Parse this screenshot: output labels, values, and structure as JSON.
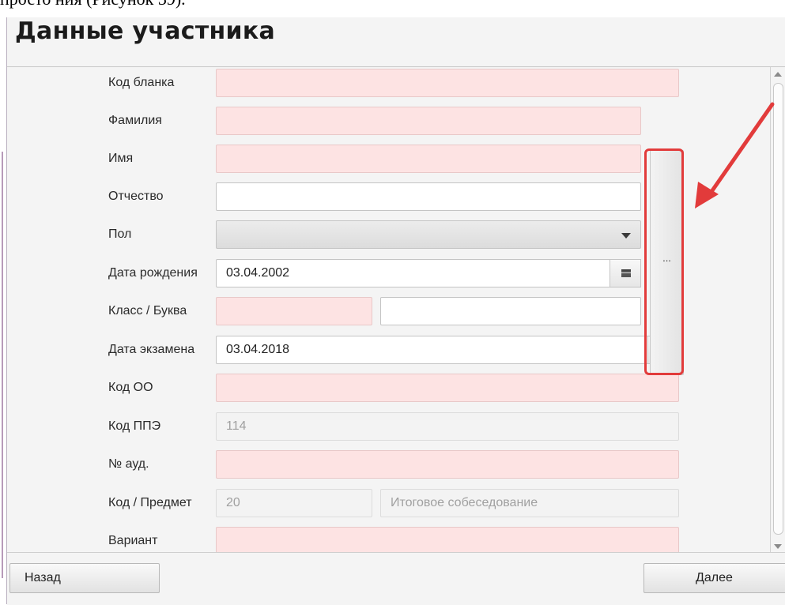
{
  "doc_fragment_text": "просто ния (Рисунок 39).",
  "header": {
    "title": "Данные участника"
  },
  "form": {
    "rows": [
      {
        "label": "Код бланка",
        "value": ""
      },
      {
        "label": "Фамилия",
        "value": ""
      },
      {
        "label": "Имя",
        "value": ""
      },
      {
        "label": "Отчество",
        "value": ""
      },
      {
        "label": "Пол",
        "value": ""
      },
      {
        "label": "Дата рождения",
        "value": "03.04.2002"
      },
      {
        "label": "Класс / Буква",
        "value": "",
        "value2": ""
      },
      {
        "label": "Дата экзамена",
        "value": "03.04.2018"
      },
      {
        "label": "Код ОО",
        "value": ""
      },
      {
        "label": "Код ППЭ",
        "value": "114"
      },
      {
        "label": "№ ауд.",
        "value": ""
      },
      {
        "label": "Код / Предмет",
        "value": "20",
        "value2": "Итоговое собеседование"
      },
      {
        "label": "Вариант",
        "value": ""
      }
    ],
    "dots_button_label": "...",
    "calendar_icon": "calendar-icon",
    "dropdown_icon": "chevron-down-icon"
  },
  "footer": {
    "back_label": "Назад",
    "next_label": "Далее"
  },
  "colors": {
    "required_field": "#fde3e3",
    "highlight": "#e23b3b",
    "background": "#f4f4f4"
  }
}
